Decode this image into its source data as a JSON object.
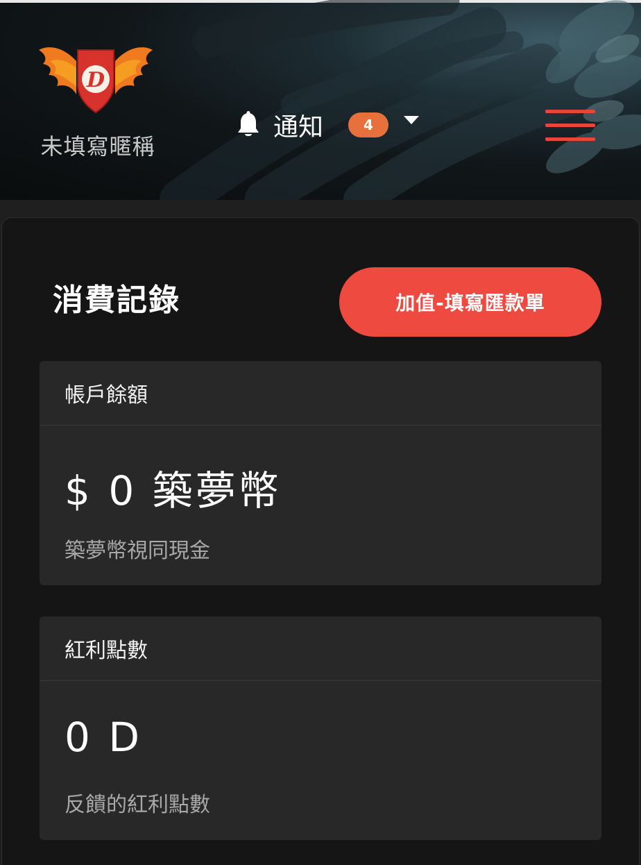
{
  "header": {
    "nickname": "未填寫暱稱",
    "notify_label": "通知",
    "notify_count": "4",
    "logo_letter": "D"
  },
  "main": {
    "title": "消費記錄",
    "topup_button": "加值-填寫匯款單"
  },
  "balance_card": {
    "heading": "帳戶餘額",
    "value": "$ 0 築夢幣",
    "note": "築夢幣視同現金"
  },
  "bonus_card": {
    "heading": "紅利點數",
    "value": "0 D",
    "note": "反饋的紅利點數"
  },
  "colors": {
    "accent": "#ef4a40",
    "badge": "#e8703c",
    "card": "#282828",
    "panel": "#151515"
  },
  "icons": [
    "winged-shield-logo-icon",
    "bell-icon",
    "caret-down-icon",
    "hamburger-menu-icon"
  ]
}
